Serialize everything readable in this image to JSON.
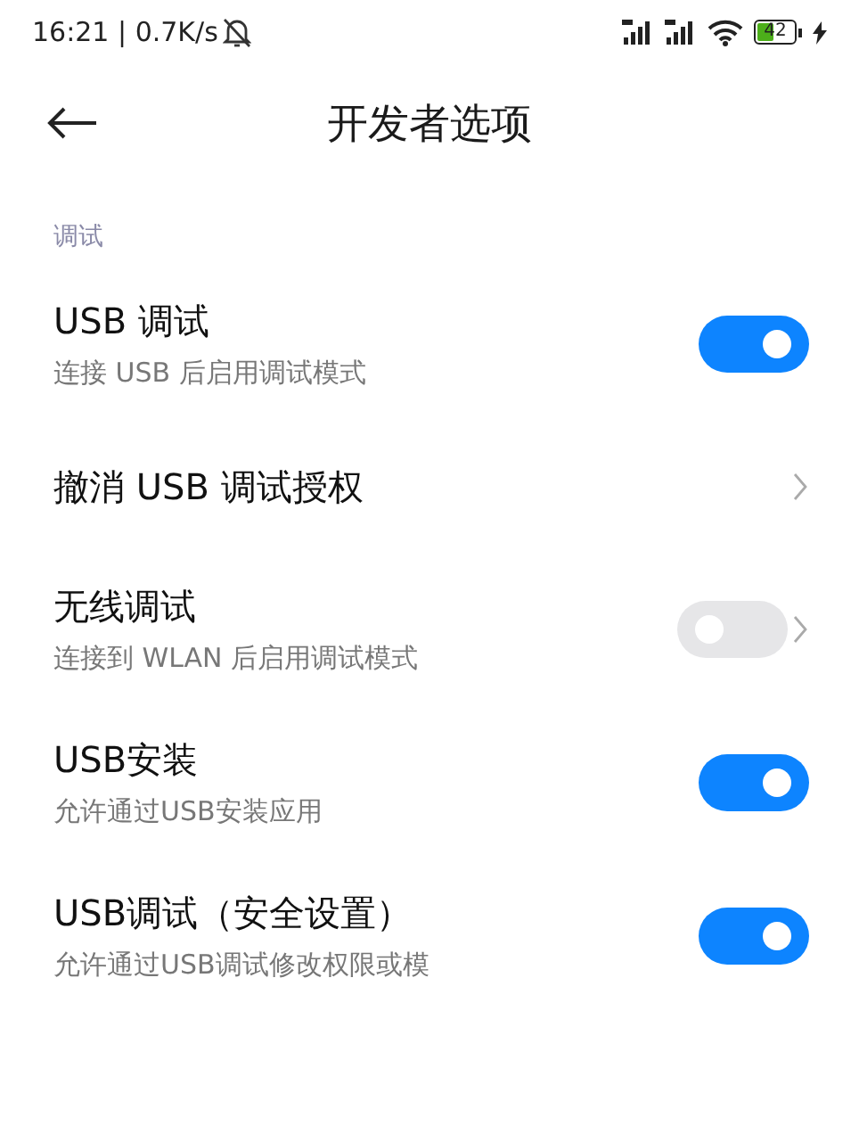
{
  "status_bar": {
    "time": "16:21 | 0.7K/s",
    "battery": "42"
  },
  "header": {
    "title": "开发者选项"
  },
  "section": {
    "label": "调试"
  },
  "rows": [
    {
      "kind": "toggle",
      "title": "USB 调试",
      "subtitle": "连接 USB 后启用调试模式",
      "on": true
    },
    {
      "kind": "link",
      "title": "撤消 USB 调试授权"
    },
    {
      "kind": "toggle_link",
      "title": "无线调试",
      "subtitle": "连接到 WLAN 后启用调试模式",
      "on": false
    },
    {
      "kind": "toggle",
      "title": "USB安装",
      "subtitle": "允许通过USB安装应用",
      "on": true
    },
    {
      "kind": "toggle",
      "title": "USB调试（安全设置）",
      "subtitle": "允许通过USB调试修改权限或模",
      "on": true
    }
  ]
}
